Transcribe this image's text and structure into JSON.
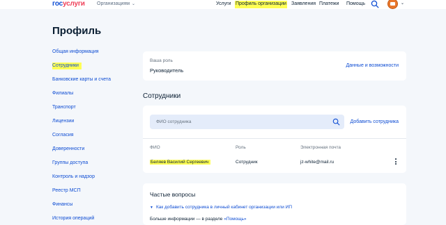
{
  "header": {
    "logo_part1": "гос",
    "logo_part2": "услуги",
    "org_dropdown": "Организациям",
    "nav": [
      "Услуги",
      "Профиль организации",
      "Заявления",
      "Платежи",
      "Помощь"
    ],
    "active_nav": "Профиль организации"
  },
  "page": {
    "title": "Профиль"
  },
  "sidebar": {
    "items": [
      "Общая информация",
      "Сотрудники",
      "Банковские карты и счета",
      "Филиалы",
      "Транспорт",
      "Лицензии",
      "Согласия",
      "Доверенности",
      "Группы доступа",
      "Контроль и надзор",
      "Реестр МСП",
      "Финансы",
      "История операций"
    ],
    "active": "Сотрудники"
  },
  "role_card": {
    "label": "Ваша роль",
    "value": "Руководитель",
    "link": "Данные и возможности"
  },
  "employees": {
    "title": "Сотрудники",
    "search_placeholder": "ФИО сотрудника",
    "add_button": "Добавить сотрудника",
    "columns": [
      "ФИО",
      "Роль",
      "Электронная почта"
    ],
    "rows": [
      {
        "name": "Беляев Василий Сергеевич",
        "role": "Сотрудник",
        "email": "jz-white@mail.ru"
      }
    ]
  },
  "faq": {
    "title": "Частые вопросы",
    "question": "Как добавить сотрудника в личный кабинет организации или ИП",
    "more_prefix": "Больше информации — в разделе",
    "more_link": "«Помощь»"
  },
  "colors": {
    "accent": "#0d4cd3",
    "logo_red": "#ee3f58",
    "highlight": "#ffff54",
    "background": "#f4f7fb",
    "avatar": "#e9762b"
  },
  "icons": [
    "search-icon",
    "chevron-down-icon",
    "avatar",
    "kebab-menu-icon"
  ]
}
